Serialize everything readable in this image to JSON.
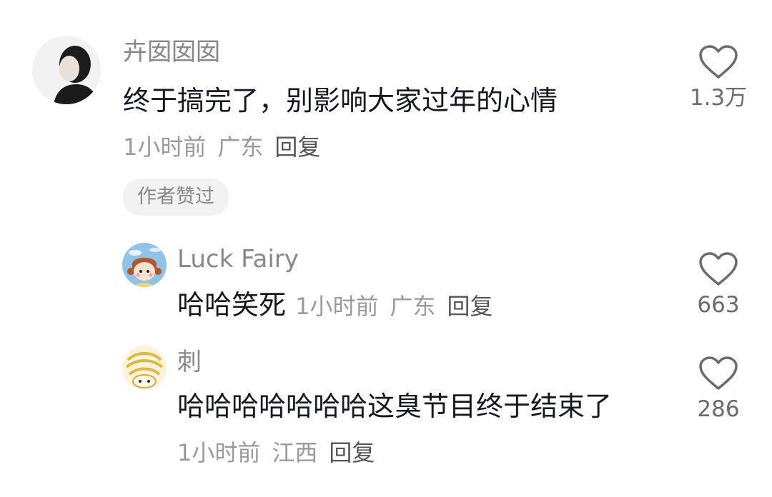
{
  "comments": [
    {
      "user": "卉囡囡囡",
      "text": "终于搞完了，别影响大家过年的心情",
      "time": "1小时前",
      "location": "广东",
      "reply_label": "回复",
      "badge": "作者赞过",
      "likes": "1.3万",
      "avatar_icon": "profile-photo-avatar"
    },
    {
      "user": "Luck Fairy",
      "text": "哈哈笑死",
      "time": "1小时前",
      "location": "广东",
      "reply_label": "回复",
      "likes": "663",
      "avatar_icon": "cartoon-girl-avatar"
    },
    {
      "user": "刺",
      "text": "哈哈哈哈哈哈哈这臭节目终于结束了",
      "time": "1小时前",
      "location": "江西",
      "reply_label": "回复",
      "likes": "286",
      "avatar_icon": "cartoon-face-avatar"
    }
  ],
  "colors": {
    "text": "#161823",
    "username": "#888888",
    "meta": "#9a9a9a",
    "heart_outline": "#6b6b6b",
    "badge_bg": "#f2f2f2"
  }
}
